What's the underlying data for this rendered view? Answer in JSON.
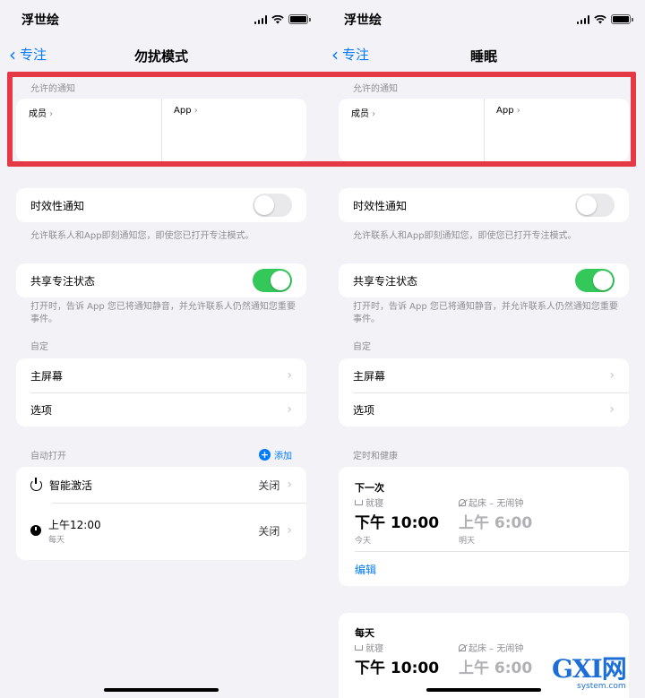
{
  "status_bar": {
    "carrier": "浮世绘"
  },
  "left": {
    "nav": {
      "back_label": "专注",
      "title": "勿扰模式"
    },
    "allowed": {
      "header": "允许的通知",
      "people_label": "成员",
      "apps_label": "App"
    },
    "time_sensitive": {
      "label": "时效性通知",
      "on": false,
      "footnote": "允许联系人和App即刻通知您，即使您已打开专注模式。"
    },
    "share_status": {
      "label": "共享专注状态",
      "on": true,
      "footnote": "打开时，告诉 App 您已将通知静音，并允许联系人仍然通知您重要事件。"
    },
    "customize": {
      "header": "自定",
      "items": [
        {
          "label": "主屏幕"
        },
        {
          "label": "选项"
        }
      ]
    },
    "auto_on": {
      "header": "自动打开",
      "add_label": "添加",
      "items": [
        {
          "icon": "power-icon",
          "label": "智能激活",
          "sublabel": "",
          "value": "关闭"
        },
        {
          "icon": "clock-icon",
          "label": "上午12:00",
          "sublabel": "每天",
          "value": "关闭"
        }
      ]
    }
  },
  "right": {
    "nav": {
      "back_label": "专注",
      "title": "睡眠"
    },
    "allowed": {
      "header": "允许的通知",
      "people_label": "成员",
      "apps_label": "App"
    },
    "time_sensitive": {
      "label": "时效性通知",
      "on": false,
      "footnote": "允许联系人和App即刻通知您，即使您已打开专注模式。"
    },
    "share_status": {
      "label": "共享专注状态",
      "on": true,
      "footnote": "打开时，告诉 App 您已将通知静音，并允许联系人仍然通知您重要事件。"
    },
    "customize": {
      "header": "自定",
      "items": [
        {
          "label": "主屏幕"
        },
        {
          "label": "选项"
        }
      ]
    },
    "schedule": {
      "header": "定时和健康",
      "next": {
        "heading": "下一次",
        "bedtime_label": "就寝",
        "bedtime_time": "下午 10:00",
        "bedtime_day": "今天",
        "wake_label": "起床 – 无闹钟",
        "wake_time": "上午 6:00",
        "wake_day": "明天",
        "edit_label": "编辑"
      },
      "daily": {
        "heading": "每天",
        "bedtime_label": "就寝",
        "bedtime_time": "下午 10:00",
        "wake_label": "起床 – 无闹钟",
        "wake_time": "上午 6:00"
      }
    }
  },
  "watermark": {
    "text": "GXI网",
    "sub": "system.com"
  },
  "colors": {
    "accent": "#007aff",
    "toggle_on": "#34c759",
    "highlight": "#e63946",
    "background": "#f2f2f7"
  }
}
